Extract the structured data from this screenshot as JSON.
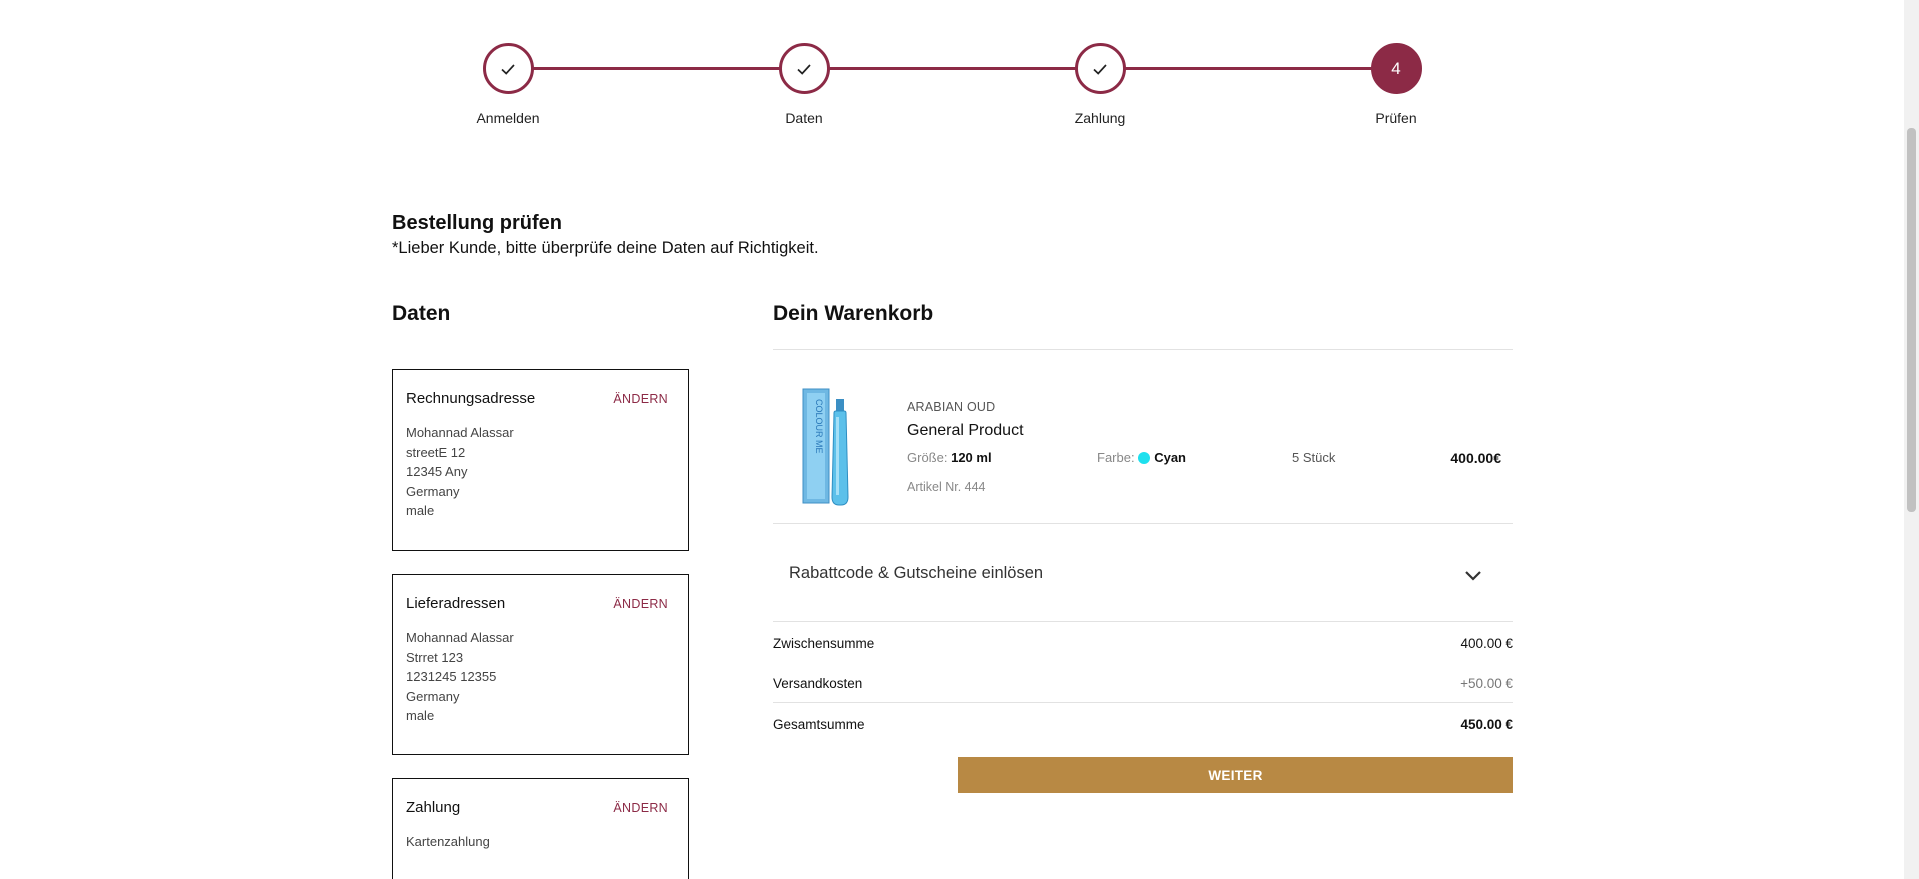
{
  "stepper": {
    "steps": [
      {
        "label": "Anmelden",
        "state": "done",
        "icon": "check-icon"
      },
      {
        "label": "Daten",
        "state": "done",
        "icon": "check-icon"
      },
      {
        "label": "Zahlung",
        "state": "done",
        "icon": "check-icon"
      },
      {
        "label": "Prüfen",
        "state": "active",
        "number": "4"
      }
    ],
    "color": "#8c2a46"
  },
  "page": {
    "title": "Bestellung prüfen",
    "subtitle": "*Lieber Kunde, bitte überprüfe deine Daten auf Richtigkeit."
  },
  "data_section": {
    "title": "Daten",
    "edit_label": "ÄNDERN",
    "billing": {
      "title": "Rechnungsadresse",
      "lines": [
        "Mohannad Alassar",
        "streetE 12",
        "12345 Any",
        "Germany",
        "male"
      ]
    },
    "shipping": {
      "title": "Lieferadressen",
      "lines": [
        "Mohannad Alassar",
        "Strret 123",
        "1231245 12355",
        "Germany",
        "male"
      ]
    },
    "payment": {
      "title": "Zahlung",
      "lines": [
        "Kartenzahlung"
      ]
    }
  },
  "cart": {
    "title": "Dein Warenkorb",
    "item": {
      "brand": "ARABIAN OUD",
      "name": "General Product",
      "size_label": "Größe:",
      "size_value": "120 ml",
      "color_label": "Farbe:",
      "color_value": "Cyan",
      "color_hex": "#1ee0ee",
      "quantity": "5 Stück",
      "article": "Artikel Nr. 444",
      "price": "400.00€",
      "image_text": "COLOUR ME"
    },
    "coupon_label": "Rabattcode & Gutscheine einlösen",
    "subtotal_label": "Zwischensumme",
    "subtotal_value": "400.00 €",
    "shipping_label": "Versandkosten",
    "shipping_value": "+50.00 €",
    "total_label": "Gesamtsumme",
    "total_value": "450.00 €",
    "continue_label": "WEITER",
    "button_color": "#b88944"
  }
}
